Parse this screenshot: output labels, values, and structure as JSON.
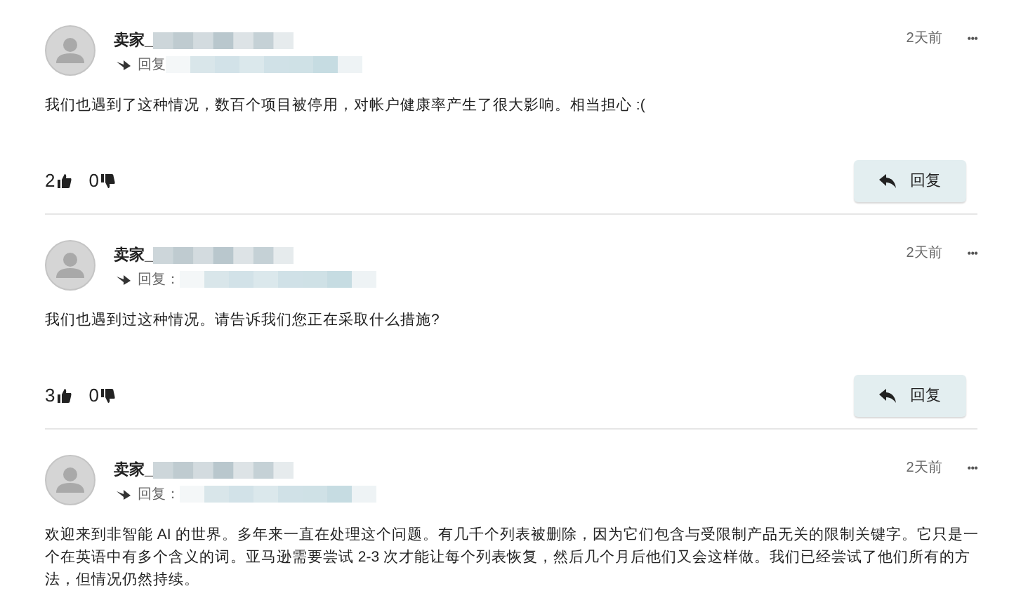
{
  "posts": [
    {
      "author": "卖家_",
      "reply_label": "回复",
      "time": "2天前",
      "more": "•••",
      "body": "我们也遇到了这种情况，数百个项目被停用，对帐户健康率产生了很大影响。相当担心 :(",
      "footer": {
        "likes": "2",
        "dislikes": "0",
        "reply_button": "回复"
      }
    },
    {
      "author": "卖家_",
      "reply_label": "回复：",
      "time": "2天前",
      "more": "•••",
      "body": "我们也遇到过这种情况。请告诉我们您正在采取什么措施?",
      "footer": {
        "likes": "3",
        "dislikes": "0",
        "reply_button": "回复"
      }
    },
    {
      "author": "卖家_",
      "reply_label": "回复：",
      "time": "2天前",
      "more": "•••",
      "body": "欢迎来到非智能 AI 的世界。多年来一直在处理这个问题。有几千个列表被删除，因为它们包含与受限制产品无关的限制关键字。它只是一个在英语中有多个含义的词。亚马逊需要尝试 2-3 次才能让每个列表恢复，然后几个月后他们又会这样做。我们已经尝试了他们所有的方法，但情况仍然持续。"
    }
  ]
}
